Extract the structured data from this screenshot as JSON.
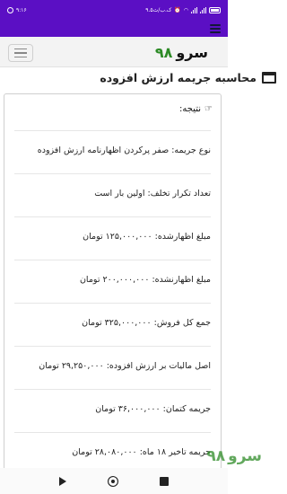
{
  "status_bar": {
    "time": "۹:۱۶",
    "net_speed": "۹.۵ک.ب/ث",
    "battery": "",
    "icons": [
      "battery-icon",
      "signal-icon",
      "signal-icon",
      "wifi-icon",
      "alarm-icon",
      "data-saver-icon"
    ]
  },
  "header": {
    "brand_number": "۹۸",
    "brand_text": "سرو"
  },
  "page": {
    "title": "محاسبه جریمه ارزش افزوده"
  },
  "result": {
    "heading": "نتیجه:",
    "rows": [
      "نوع جریمه: صفر پرکردن اظهارنامه ارزش افزوده",
      "تعداد تکرار تخلف: اولین بار است",
      "مبلغ اظهارشده: ۱۲۵,۰۰۰,۰۰۰ تومان",
      "مبلغ اظهارنشده: ۲۰۰,۰۰۰,۰۰۰ تومان",
      "جمع کل فروش: ۳۲۵,۰۰۰,۰۰۰ تومان",
      "اصل مالیات بر ارزش افزوده: ۲۹,۲۵۰,۰۰۰ تومان",
      "جریمه کتمان: ۳۶,۰۰۰,۰۰۰ تومان",
      "جریمه تاخیر ۱۸ ماه: ۲۸,۰۸۰,۰۰۰ تومان"
    ]
  },
  "watermark": {
    "number": "۹۸",
    "text": "سرو"
  },
  "colors": {
    "status_bar": "#5b0fc4",
    "brand_green": "#2e8b27"
  }
}
